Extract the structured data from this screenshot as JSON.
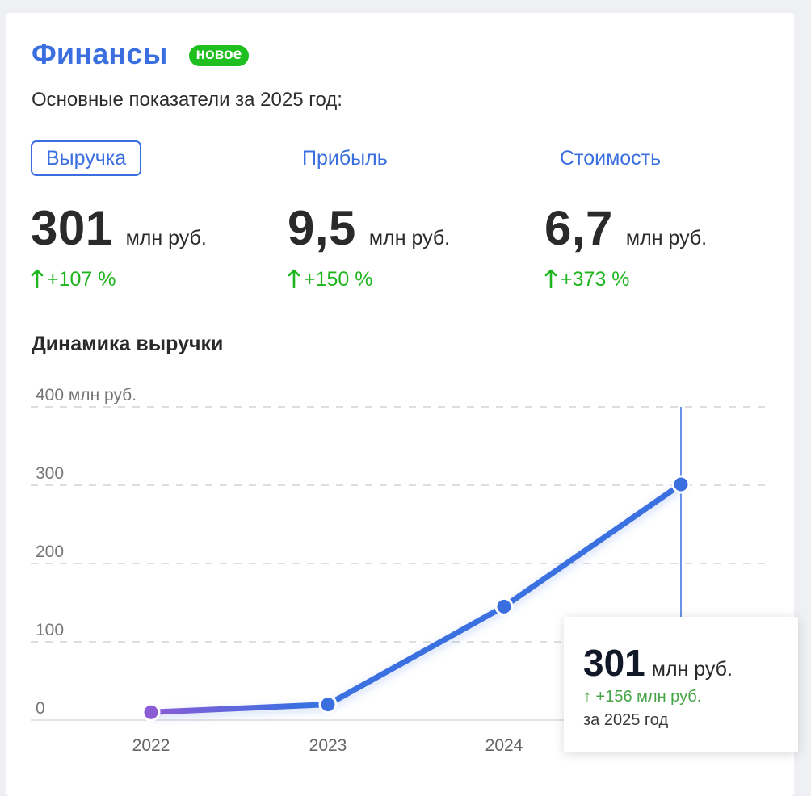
{
  "header": {
    "title": "Финансы",
    "badge": "новое"
  },
  "subtitle": "Основные показатели за 2025 год:",
  "tabs": [
    {
      "label": "Выручка",
      "active": true
    },
    {
      "label": "Прибыль",
      "active": false
    },
    {
      "label": "Стоимость",
      "active": false
    }
  ],
  "metrics": [
    {
      "value": "301",
      "unit": "млн руб.",
      "change": "+107 %"
    },
    {
      "value": "9,5",
      "unit": "млн руб.",
      "change": "+150 %"
    },
    {
      "value": "6,7",
      "unit": "млн руб.",
      "change": "+373 %"
    }
  ],
  "chart_section_title": "Динамика выручки",
  "chart_data": {
    "type": "line",
    "x": [
      "2022",
      "2023",
      "2024",
      "2025"
    ],
    "series": [
      {
        "values": [
          10,
          20,
          145,
          301
        ]
      }
    ],
    "ylim": [
      0,
      400
    ],
    "yticks": [
      0,
      100,
      200,
      300,
      400
    ],
    "ytick_labels": [
      "0",
      "100",
      "200",
      "300",
      "400 млн руб."
    ],
    "xtick_labels": [
      "2022",
      "2023",
      "2024"
    ],
    "grid": true,
    "highlight_index": 3,
    "colors": {
      "line": "#3b6fe0",
      "line_start": "#8b5cd6",
      "grid": "#d4d4d4"
    }
  },
  "tooltip": {
    "value": "301",
    "unit": "млн руб.",
    "change": "↑ +156 млн руб.",
    "period": "за 2025 год"
  },
  "icons": {
    "change_arrow": "arrow-up-icon"
  },
  "colors": {
    "accent": "#3b6fe0",
    "positive": "#1fb51f",
    "badge": "#1fbf1f"
  }
}
